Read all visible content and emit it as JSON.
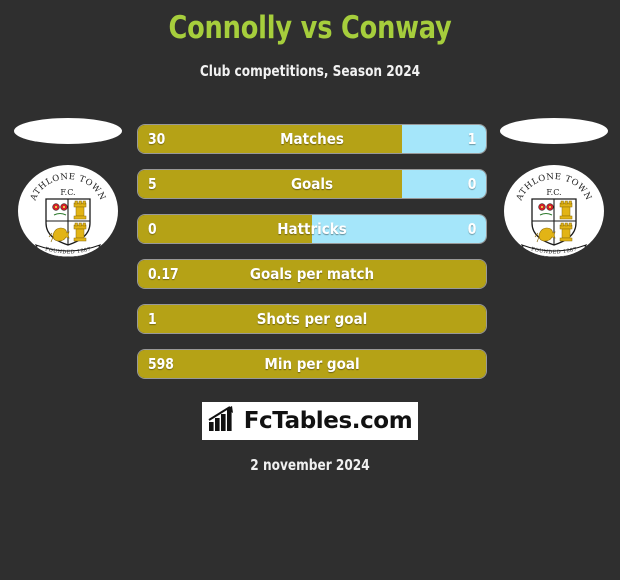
{
  "header": {
    "title": "Connolly vs Conway",
    "subtitle": "Club competitions, Season 2024",
    "title_color": "#a6ce3c"
  },
  "colors": {
    "background": "#2f2f2f",
    "home_bar": "#b5a216",
    "away_bar": "#a5e6fa",
    "text": "#ffffff"
  },
  "teams": {
    "left": {
      "crest_name": "athlone-town-fc",
      "crest_title": "ATHLONE TOWN",
      "crest_subtitle": "F.C."
    },
    "right": {
      "crest_name": "athlone-town-fc",
      "crest_title": "ATHLONE TOWN",
      "crest_subtitle": "F.C."
    }
  },
  "chart_data": {
    "type": "bar",
    "title": "Connolly vs Conway",
    "subtitle": "Club competitions, Season 2024",
    "orientation": "horizontal-split",
    "series": [
      {
        "name": "Connolly",
        "color": "#b5a216"
      },
      {
        "name": "Conway",
        "color": "#a5e6fa"
      }
    ],
    "categories": [
      "Matches",
      "Goals",
      "Hattricks",
      "Goals per match",
      "Shots per goal",
      "Min per goal"
    ],
    "rows": [
      {
        "label": "Matches",
        "home": "30",
        "away": "1",
        "home_pct": 76,
        "has_away": true
      },
      {
        "label": "Goals",
        "home": "5",
        "away": "0",
        "home_pct": 76,
        "has_away": true
      },
      {
        "label": "Hattricks",
        "home": "0",
        "away": "0",
        "home_pct": 50,
        "has_away": true
      },
      {
        "label": "Goals per match",
        "home": "0.17",
        "away": "",
        "home_pct": 100,
        "has_away": false
      },
      {
        "label": "Shots per goal",
        "home": "1",
        "away": "",
        "home_pct": 100,
        "has_away": false
      },
      {
        "label": "Min per goal",
        "home": "598",
        "away": "",
        "home_pct": 100,
        "has_away": false
      }
    ]
  },
  "footer": {
    "logo_text": "FcTables.com",
    "logo_icon": "bar-chart-icon",
    "date": "2 november 2024"
  }
}
